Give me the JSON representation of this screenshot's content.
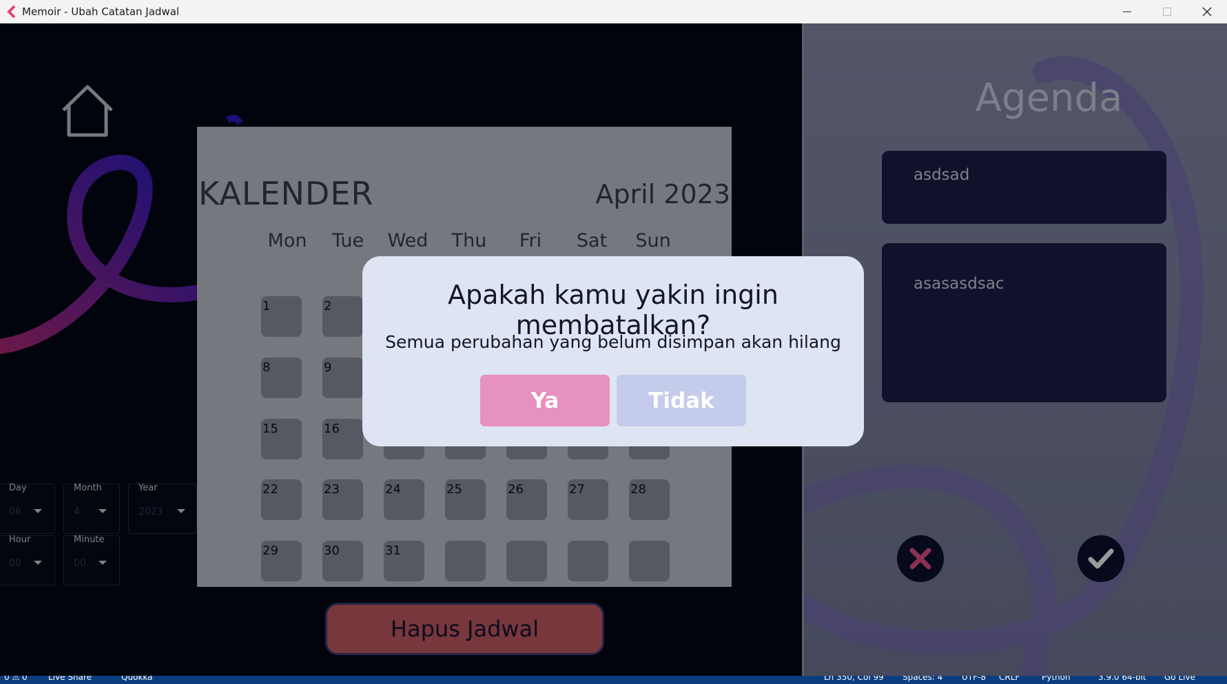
{
  "window": {
    "title": "Memoir - Ubah Catatan Jadwal",
    "controls": [
      "minimize",
      "maximize",
      "close"
    ]
  },
  "calendar": {
    "title": "KALENDER",
    "month_year": "April 2023",
    "weekdays": [
      "Mon",
      "Tue",
      "Wed",
      "Thu",
      "Fri",
      "Sat",
      "Sun"
    ],
    "rows": [
      [
        "1",
        "2",
        "",
        "",
        "",
        "",
        ""
      ],
      [
        "8",
        "9",
        "",
        "",
        "",
        "",
        ""
      ],
      [
        "15",
        "16",
        "",
        "",
        "",
        "",
        ""
      ],
      [
        "22",
        "23",
        "24",
        "25",
        "26",
        "27",
        "28"
      ],
      [
        "29",
        "30",
        "31",
        "",
        "",
        "",
        ""
      ]
    ]
  },
  "datetime_fields": {
    "day": {
      "label": "Day",
      "value": "06"
    },
    "month": {
      "label": "Month",
      "value": "4"
    },
    "year": {
      "label": "Year",
      "value": "2023"
    },
    "hour": {
      "label": "Hour",
      "value": "00"
    },
    "minute": {
      "label": "Minute",
      "value": "00"
    }
  },
  "delete_button": {
    "label": "Hapus Jadwal"
  },
  "agenda": {
    "title": "Agenda",
    "title_field": "asdsad",
    "description_field": "asasasdsac"
  },
  "dialog": {
    "title": "Apakah kamu yakin ingin membatalkan?",
    "message": "Semua perubahan yang belum disimpan akan hilang",
    "yes_label": "Ya",
    "no_label": "Tidak"
  },
  "statusbar": {
    "left_items": [
      "0 ⚠ 0",
      "Live Share",
      "Quokka"
    ],
    "right_items": [
      "Ln 350, Col 99",
      "Spaces: 4",
      "UTF-8",
      "CRLF",
      "Python",
      "3.9.0 64-bit",
      "Go Live"
    ]
  },
  "colors": {
    "left_bg": "#020717",
    "accent_pink": "#e691bf",
    "accent_lavender": "#c5cbea",
    "delete_red": "#c85d67",
    "agenda_box": "#1b1d48"
  }
}
